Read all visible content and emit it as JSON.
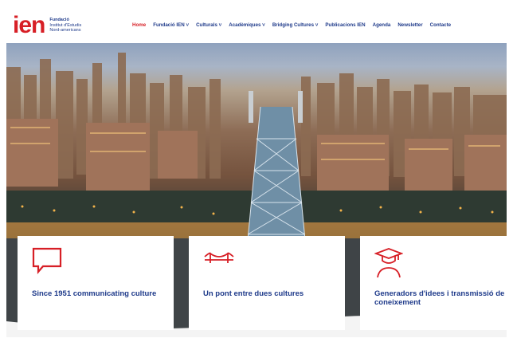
{
  "header": {
    "logo_mark": "ien",
    "logo_lines": [
      "Fundació",
      "Institut d'Estudis",
      "Nord-americans"
    ]
  },
  "nav": {
    "items": [
      {
        "label": "Home",
        "active": true
      },
      {
        "label": "Fundació IEN ˅"
      },
      {
        "label": "Culturals ˅"
      },
      {
        "label": "Acadèmiques ˅"
      },
      {
        "label": "Bridging Cultures ˅"
      },
      {
        "label": "Publicacions IEN"
      },
      {
        "label": "Agenda"
      },
      {
        "label": "Newsletter"
      },
      {
        "label": "Contacte"
      }
    ]
  },
  "cards": [
    {
      "icon": "speech-bubble-icon",
      "title": "Since 1951 communicating culture"
    },
    {
      "icon": "bridge-icon",
      "title": "Un pont entre dues cultures"
    },
    {
      "icon": "graduate-icon",
      "title": "Generadors d'idees i transmissió de coneixement"
    }
  ],
  "colors": {
    "brand_red": "#d71f26",
    "brand_blue": "#1e3a8a"
  }
}
